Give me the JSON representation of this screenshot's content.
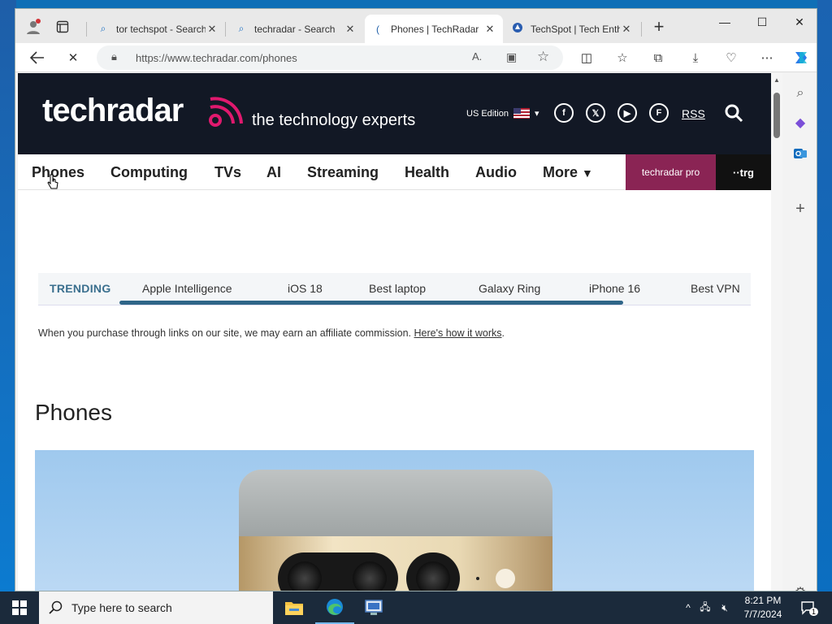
{
  "browser": {
    "tabs": [
      {
        "title": "tor techspot - Search",
        "favicon": "search-icon"
      },
      {
        "title": "techradar - Search",
        "favicon": "search-icon"
      },
      {
        "title": "Phones | TechRadar",
        "favicon": "techradar-icon",
        "active": true
      },
      {
        "title": "TechSpot | Tech Enthusiasts",
        "favicon": "techspot-icon"
      }
    ],
    "url": "https://www.techradar.com/phones"
  },
  "site": {
    "logo": "techradar",
    "tagline": "the technology experts",
    "edition": "US Edition",
    "rss": "RSS",
    "nav": [
      "Phones",
      "Computing",
      "TVs",
      "AI",
      "Streaming",
      "Health",
      "Audio",
      "More"
    ],
    "pro_label": "techradar pro",
    "trg_label": "trg",
    "trending_label": "TRENDING",
    "trending": [
      "Apple Intelligence",
      "iOS 18",
      "Best laptop",
      "Galaxy Ring",
      "iPhone 16",
      "Best VPN"
    ],
    "affiliate_text": "When you purchase through links on our site, we may earn an affiliate commission.",
    "affiliate_link": "Here's how it works",
    "page_heading": "Phones",
    "accent_color": "#e0196e",
    "header_bg": "#121825"
  },
  "taskbar": {
    "search_placeholder": "Type here to search",
    "time": "8:21 PM",
    "date": "7/7/2024",
    "notification_count": "1"
  }
}
